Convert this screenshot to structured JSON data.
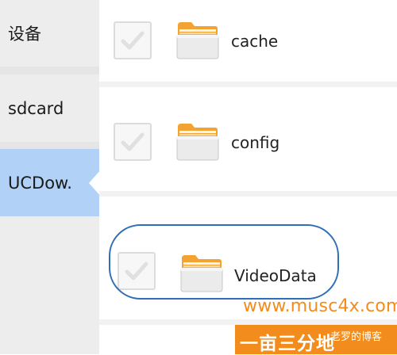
{
  "sidebar": {
    "items": [
      {
        "label": "设备"
      },
      {
        "label": "sdcard"
      },
      {
        "label": "UCDow."
      }
    ],
    "selected_index": 2,
    "selected_color": "#b1d2f6"
  },
  "files": [
    {
      "name": "cache",
      "checked": false,
      "icon": "folder-icon"
    },
    {
      "name": "config",
      "checked": false,
      "icon": "folder-icon"
    },
    {
      "name": "VideoData",
      "checked": false,
      "icon": "folder-icon",
      "highlighted": true
    }
  ],
  "watermark": {
    "url": "www.musc4x.com",
    "brand": "一亩三分地",
    "tagline": "老罗的博客"
  },
  "colors": {
    "folder_tab": "#f3a331",
    "folder_body": "#ebebeb",
    "highlight": "#2f6fb6",
    "watermark": "#f28c1c"
  }
}
